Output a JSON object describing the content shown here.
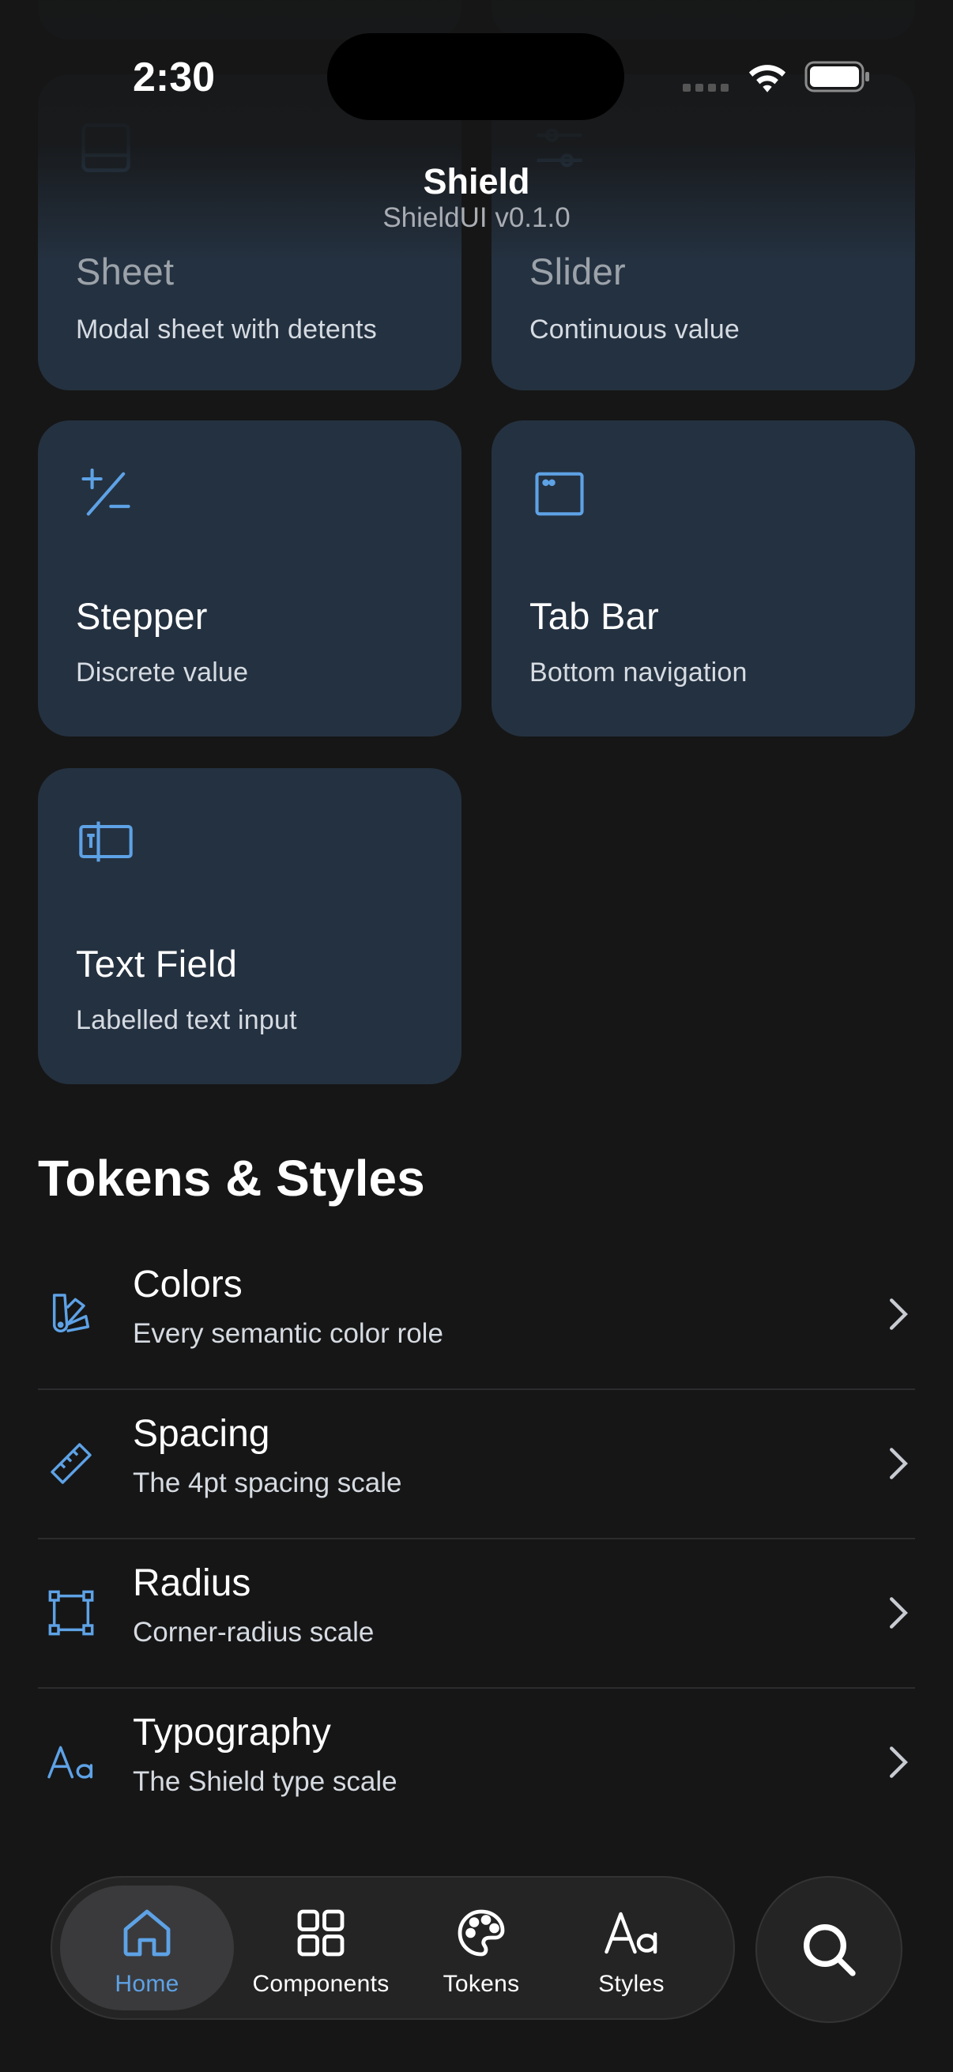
{
  "status_bar": {
    "time": "2:30"
  },
  "nav": {
    "title": "Shield",
    "subtitle": "ShieldUI v0.1.0"
  },
  "component_cards": [
    {
      "title": "Sheet",
      "subtitle": "Modal sheet with detents",
      "icon": "sheet-icon"
    },
    {
      "title": "Slider",
      "subtitle": "Continuous value",
      "icon": "slider-icon"
    },
    {
      "title": "Stepper",
      "subtitle": "Discrete value",
      "icon": "plus-minus-icon"
    },
    {
      "title": "Tab Bar",
      "subtitle": "Bottom navigation",
      "icon": "window-icon"
    },
    {
      "title": "Text Field",
      "subtitle": "Labelled text input",
      "icon": "text-field-icon"
    }
  ],
  "tokens_section": {
    "title": "Tokens & Styles",
    "items": [
      {
        "title": "Colors",
        "subtitle": "Every semantic color role",
        "icon": "swatch-icon"
      },
      {
        "title": "Spacing",
        "subtitle": "The 4pt spacing scale",
        "icon": "ruler-icon"
      },
      {
        "title": "Radius",
        "subtitle": "Corner-radius scale",
        "icon": "radius-icon"
      },
      {
        "title": "Typography",
        "subtitle": "The Shield type scale",
        "icon": "typography-icon"
      }
    ]
  },
  "tab_bar": {
    "tabs": [
      {
        "label": "Home",
        "icon": "house-icon",
        "active": true
      },
      {
        "label": "Components",
        "icon": "grid-icon",
        "active": false
      },
      {
        "label": "Tokens",
        "icon": "palette-icon",
        "active": false
      },
      {
        "label": "Styles",
        "icon": "text-aa-icon",
        "active": false
      }
    ],
    "search_icon": "search-icon"
  },
  "colors": {
    "background": "#161616",
    "card": "#243140",
    "accent": "#5ea2e6"
  }
}
